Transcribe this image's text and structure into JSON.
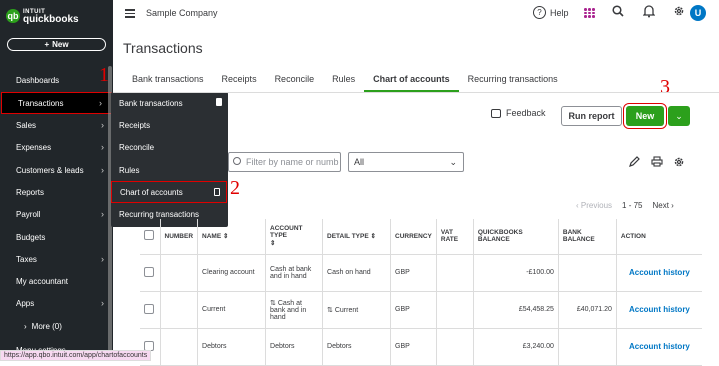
{
  "brand": {
    "intuit": "INTUIT",
    "name": "quickbooks",
    "mark": "qb"
  },
  "sidebar": {
    "new_label": "New",
    "items": [
      {
        "label": "Dashboards",
        "chevron": false
      },
      {
        "label": "Transactions",
        "chevron": true
      },
      {
        "label": "Sales",
        "chevron": true
      },
      {
        "label": "Expenses",
        "chevron": true
      },
      {
        "label": "Customers & leads",
        "chevron": true
      },
      {
        "label": "Reports",
        "chevron": false
      },
      {
        "label": "Payroll",
        "chevron": true
      },
      {
        "label": "Budgets",
        "chevron": false
      },
      {
        "label": "Taxes",
        "chevron": true
      },
      {
        "label": "My accountant",
        "chevron": false
      },
      {
        "label": "Apps",
        "chevron": true
      },
      {
        "label": "More (0)",
        "chevron": false
      },
      {
        "label": "Menu settings",
        "chevron": false
      }
    ]
  },
  "flyout": {
    "items": [
      {
        "label": "Bank transactions"
      },
      {
        "label": "Receipts"
      },
      {
        "label": "Reconcile"
      },
      {
        "label": "Rules"
      },
      {
        "label": "Chart of accounts"
      },
      {
        "label": "Recurring transactions"
      }
    ]
  },
  "topbar": {
    "company": "Sample Company",
    "help": "Help",
    "avatar": "U"
  },
  "page": {
    "title": "Transactions"
  },
  "tabs": [
    "Bank transactions",
    "Receipts",
    "Reconcile",
    "Rules",
    "Chart of accounts",
    "Recurring transactions"
  ],
  "active_tab": "Chart of accounts",
  "actions": {
    "feedback": "Feedback",
    "run_report": "Run report",
    "new": "New"
  },
  "annotations": {
    "one": "1",
    "two": "2",
    "three": "3"
  },
  "filters": {
    "search_placeholder": "Filter by name or numb",
    "type_value": "All"
  },
  "pager": {
    "previous": "‹ Previous",
    "range": "1 - 75",
    "next": "Next ›"
  },
  "table": {
    "headers": [
      "NUMBER",
      "NAME",
      "ACCOUNT TYPE",
      "DETAIL TYPE",
      "CURRENCY",
      "VAT RATE",
      "QUICKBOOKS BALANCE",
      "BANK BALANCE",
      "ACTION"
    ],
    "rows": [
      {
        "number": "",
        "name": "Clearing account",
        "account_type": "Cash at bank and in hand",
        "detail_type": "Cash on hand",
        "currency": "GBP",
        "vat": "",
        "qb_balance": "-£100.00",
        "bank_balance": "",
        "action": "Account history"
      },
      {
        "number": "",
        "name": "Current",
        "account_type": "Cash at bank and in hand",
        "detail_type": "Current",
        "currency": "GBP",
        "vat": "",
        "qb_balance": "£54,458.25",
        "bank_balance": "£40,071.20",
        "action": "Account history"
      },
      {
        "number": "",
        "name": "Debtors",
        "account_type": "Debtors",
        "detail_type": "Debtors",
        "currency": "GBP",
        "vat": "",
        "qb_balance": "£3,240.00",
        "bank_balance": "",
        "action": "Account history"
      }
    ]
  },
  "status_url": "https://app.qbo.intuit.com/app/chartofaccounts",
  "colors": {
    "accent_green": "#2ca01c",
    "sidebar_bg": "#21262a",
    "link_blue": "#0077c5",
    "annotation_red": "#e00000"
  }
}
